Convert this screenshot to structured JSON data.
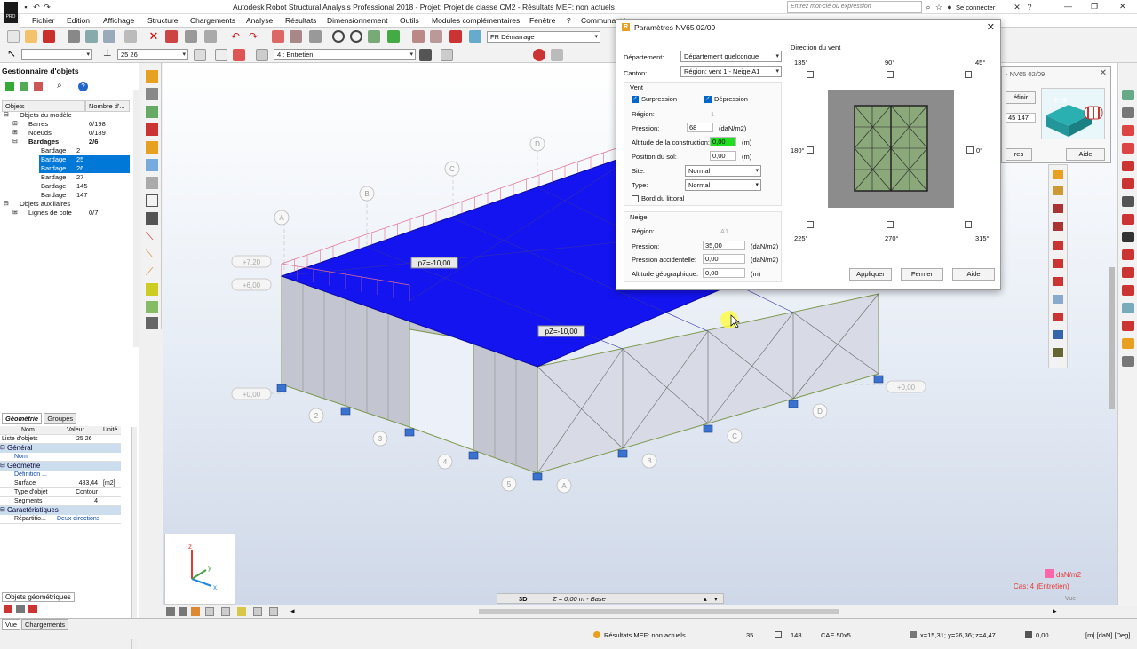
{
  "app": {
    "logo_text": "PRO",
    "title": "Autodesk Robot Structural Analysis Professional 2018 - Projet: Projet de classe CM2 - Résultats MEF: non actuels",
    "search_placeholder": "Entrez mot-clé ou expression",
    "signin": "Se connecter"
  },
  "menu": [
    "Fichier",
    "Edition",
    "Affichage",
    "Structure",
    "Chargements",
    "Analyse",
    "Résultats",
    "Dimensionnement",
    "Outils",
    "Modules complémentaires",
    "Fenêtre",
    "?",
    "Communauté"
  ],
  "toolbar": {
    "code_combo": "FR Démarrage",
    "selection_combo": "",
    "bars_combo": "25 26",
    "case_combo": "4 : Entretien"
  },
  "object_manager": {
    "title": "Gestionnaire d'objets",
    "col_objects": "Objets",
    "col_count": "Nombre d'...",
    "tree": [
      {
        "label": "Objets du modèle",
        "count": "",
        "level": 0,
        "sel": false,
        "bold": false,
        "exp": "⊟"
      },
      {
        "label": "Barres",
        "count": "0/198",
        "level": 1,
        "sel": false,
        "bold": false,
        "exp": "⊞"
      },
      {
        "label": "Noeuds",
        "count": "0/189",
        "level": 1,
        "sel": false,
        "bold": false,
        "exp": "⊞"
      },
      {
        "label": "Bardages",
        "count": "2/6",
        "level": 1,
        "sel": false,
        "bold": true,
        "exp": "⊟"
      },
      {
        "label": "Bardage",
        "count": "2",
        "level": 2,
        "sel": false,
        "bold": false,
        "exp": ""
      },
      {
        "label": "Bardage",
        "count": "25",
        "level": 2,
        "sel": true,
        "bold": false,
        "exp": ""
      },
      {
        "label": "Bardage",
        "count": "26",
        "level": 2,
        "sel": true,
        "bold": false,
        "exp": ""
      },
      {
        "label": "Bardage",
        "count": "27",
        "level": 2,
        "sel": false,
        "bold": false,
        "exp": ""
      },
      {
        "label": "Bardage",
        "count": "145",
        "level": 2,
        "sel": false,
        "bold": false,
        "exp": ""
      },
      {
        "label": "Bardage",
        "count": "147",
        "level": 2,
        "sel": false,
        "bold": false,
        "exp": ""
      },
      {
        "label": "Objets auxiliaires",
        "count": "",
        "level": 0,
        "sel": false,
        "bold": false,
        "exp": "⊟"
      },
      {
        "label": "Lignes de cote",
        "count": "0/7",
        "level": 1,
        "sel": false,
        "bold": false,
        "exp": "⊞"
      }
    ]
  },
  "geometry": {
    "tab_geometry": "Géométrie",
    "tab_groups": "Groupes",
    "col_name": "Nom",
    "col_value": "Valeur",
    "col_unit": "Unité",
    "list_label": "Liste d'objets",
    "list_value": "25 26",
    "sec_general": "Général",
    "name_label": "Nom",
    "sec_geometry": "Géométrie",
    "definition_label": "Définition ...",
    "surface_label": "Surface",
    "surface_value": "483,44",
    "surface_unit": "[m2]",
    "type_label": "Type d'objet",
    "type_value": "Contour",
    "segments_label": "Segments",
    "segments_value": "4",
    "sec_features": "Caractéristiques",
    "repart_label": "Répartitio...",
    "repart_value": "Deux directions",
    "bottom_tab": "Objets géométriques"
  },
  "viewport": {
    "load_label_1": "pZ=-10,00",
    "load_label_2": "pZ=-10,00",
    "grid_letters": [
      "A",
      "B",
      "C",
      "D"
    ],
    "grid_numbers": [
      "2",
      "3",
      "4",
      "5"
    ],
    "level_labels": [
      "+7,20",
      "+6,00",
      "+0,00",
      "+0,00"
    ],
    "bottom_view_label": "3D",
    "bottom_plane_label": "Z = 0,00 m - Base",
    "unit_label": "daN/m2",
    "case_label": "Cas: 4 (Entretien)",
    "vue_label": "Vue"
  },
  "dialog": {
    "title": "Paramètres  NV65 02/09",
    "departement_label": "Département:",
    "departement_value": "Département quelconque",
    "canton_label": "Canton:",
    "canton_value": "Région: vent 1 - Neige A1",
    "vent_group": "Vent",
    "surpression": "Surpression",
    "depression": "Dépression",
    "region_label": "Région:",
    "region_vent_value": "1",
    "pression_label": "Pression:",
    "pression_vent_value": "68",
    "pression_unit": "(daN/m2)",
    "altitude_label": "Altitude de la construction:",
    "altitude_value": "0,00",
    "m_unit": "(m)",
    "position_label": "Position du sol:",
    "position_value": "0,00",
    "site_label": "Site:",
    "site_value": "Normal",
    "type_label": "Type:",
    "type_value": "Normal",
    "littoral_label": "Bord du littoral",
    "neige_group": "Neige",
    "region_neige_value": "A1",
    "pression_neige_value": "35,00",
    "pression_acc_label": "Pression accidentelle:",
    "pression_acc_value": "0,00",
    "altitude_geo_label": "Altitude géographique:",
    "altitude_geo_value": "0,00",
    "wind_direction_label": "Direction du vent",
    "angles": {
      "a135": "135°",
      "a90": "90°",
      "a45": "45°",
      "a180": "180°",
      "a0": "0°",
      "a225": "225°",
      "a270": "270°",
      "a315": "315°"
    },
    "apply_button": "Appliquer",
    "close_button": "Fermer",
    "help_button": "Aide"
  },
  "dialog2": {
    "title": "- NV65 02/09",
    "define_button": "éfinir",
    "value": "45 147",
    "partial_button": "res",
    "help_button": "Aide"
  },
  "status": {
    "tab_view": "Vue",
    "tab_loads": "Chargements",
    "mef_status": "Résultats MEF: non actuels",
    "n1": "35",
    "n2": "148",
    "section": "CAE 50x5",
    "coords": "x=15,31; y=26,36; z=4,47",
    "zero": "0,00",
    "units": "[m] [daN] [Deg]"
  },
  "colors": {
    "roof": "#1414f0",
    "selection": "#0078d7",
    "wall": "#c9ccd6",
    "load_arrows": "#e07090",
    "accent_green": "#22dd22",
    "red_label": "#e53935"
  }
}
